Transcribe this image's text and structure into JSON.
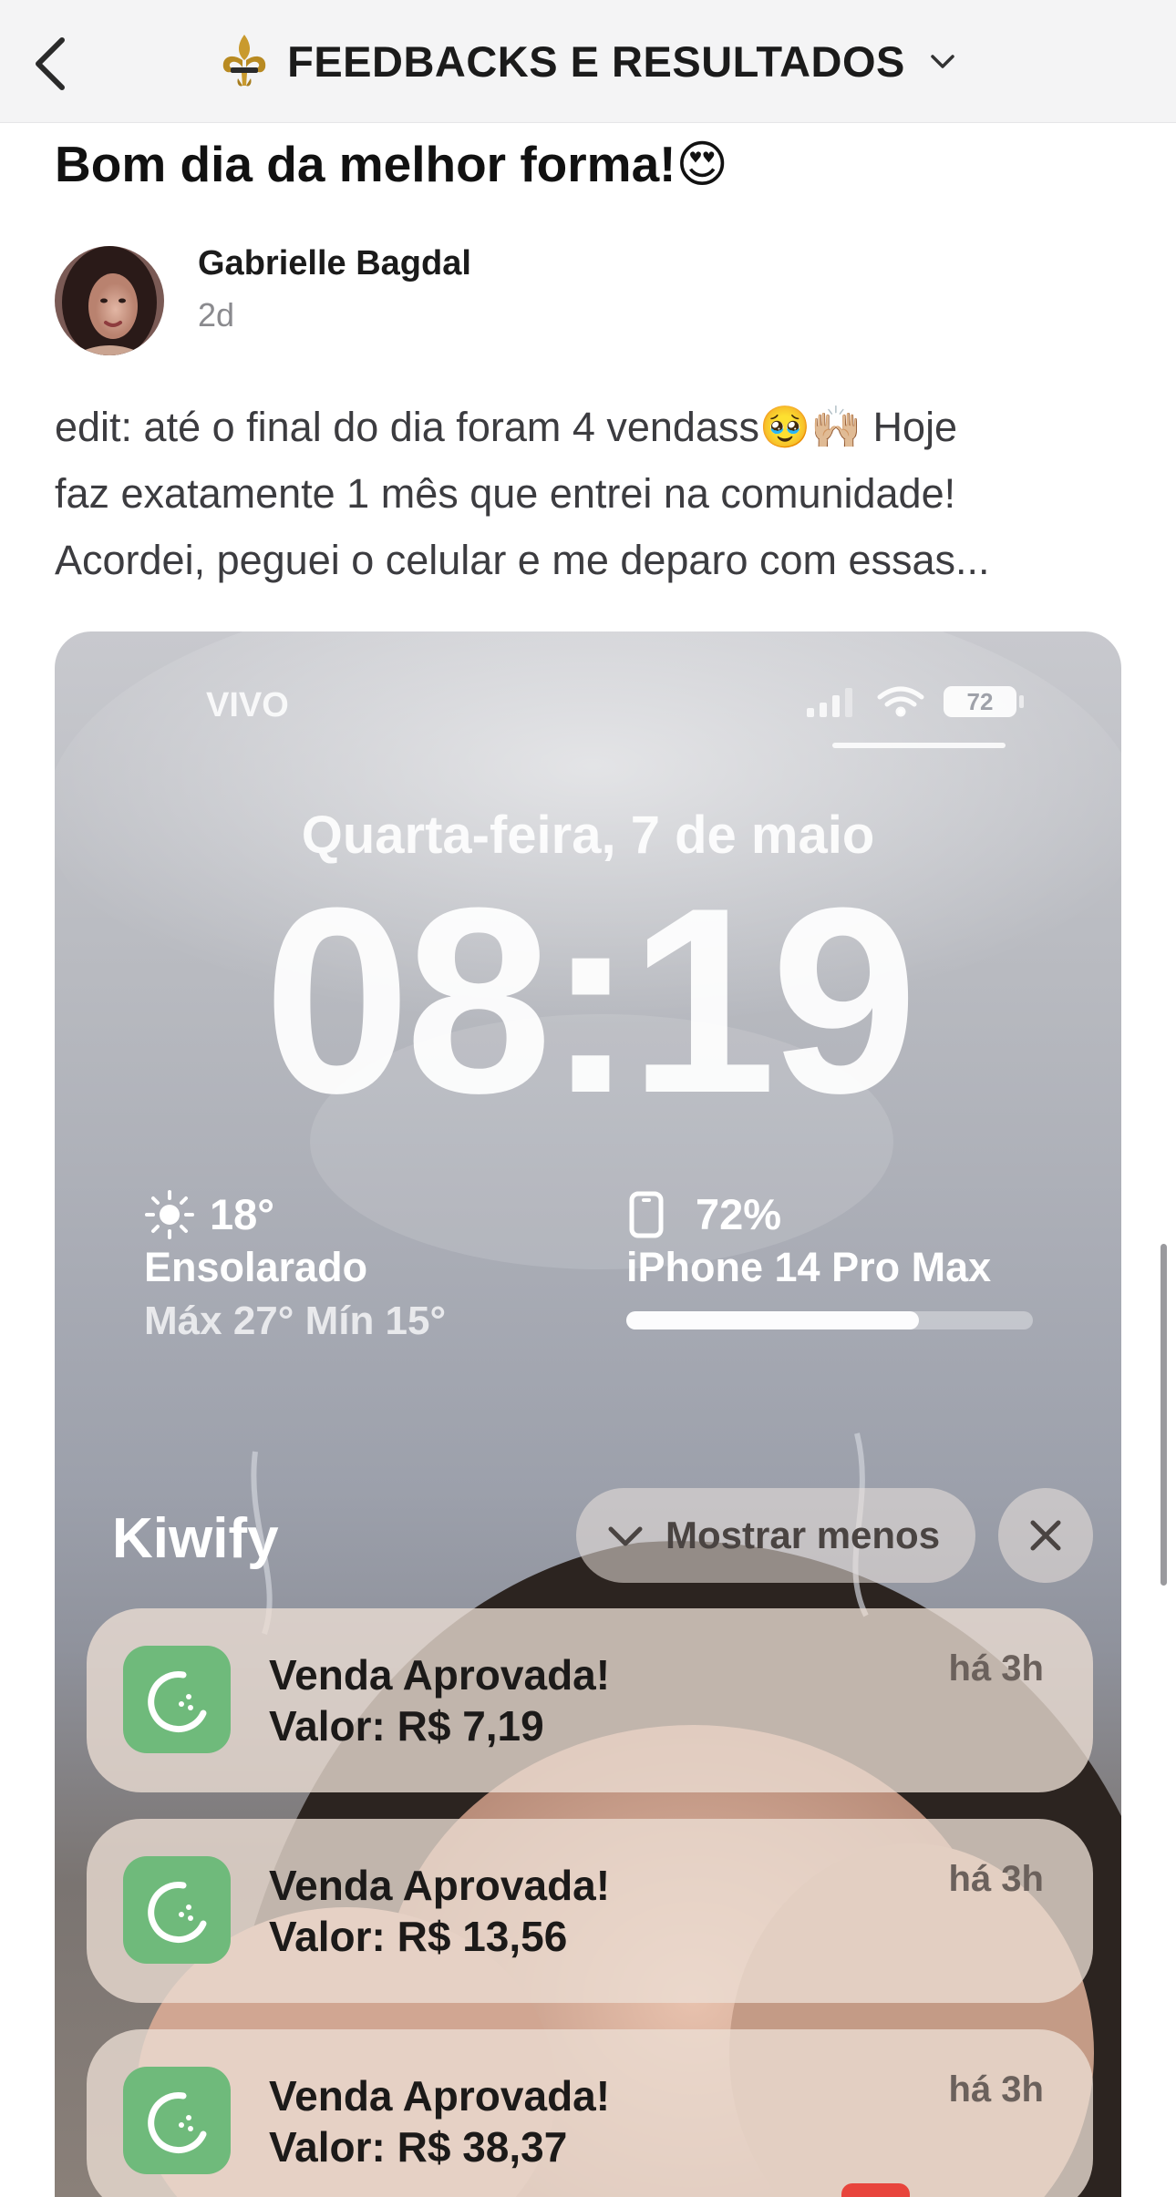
{
  "header": {
    "title": "FEEDBACKS E RESULTADOS"
  },
  "post": {
    "title": "Bom dia da melhor forma!😍",
    "author": "Gabrielle Bagdal",
    "time": "2d",
    "body_lines": [
      "edit: até o final do dia foram 4 vendass🥹🙌🏼 Hoje",
      "faz exatamente 1 mês que entrei na comunidade!",
      "Acordei, peguei o celular e me deparo com essas..."
    ]
  },
  "lockscreen": {
    "carrier": "VIVO",
    "battery_badge": "72",
    "date": "Quarta-feira, 7 de maio",
    "time": "08:19",
    "weather": {
      "temp": "18°",
      "condition": "Ensolarado",
      "max_min": "Máx 27° Mín 15°"
    },
    "battery_widget": {
      "percent_label": "72%",
      "device": "iPhone 14 Pro Max",
      "level": 0.72
    },
    "app_name": "Kiwify",
    "show_less_label": "Mostrar menos",
    "notifications": [
      {
        "title": "Venda Aprovada!",
        "value": "Valor: R$ 7,19",
        "time": "há 3h"
      },
      {
        "title": "Venda Aprovada!",
        "value": "Valor: R$ 13,56",
        "time": "há 3h"
      },
      {
        "title": "Venda Aprovada!",
        "value": "Valor: R$ 38,37",
        "time": "há 3h"
      }
    ],
    "colors": {
      "notification_icon": "#6fba7b"
    }
  }
}
